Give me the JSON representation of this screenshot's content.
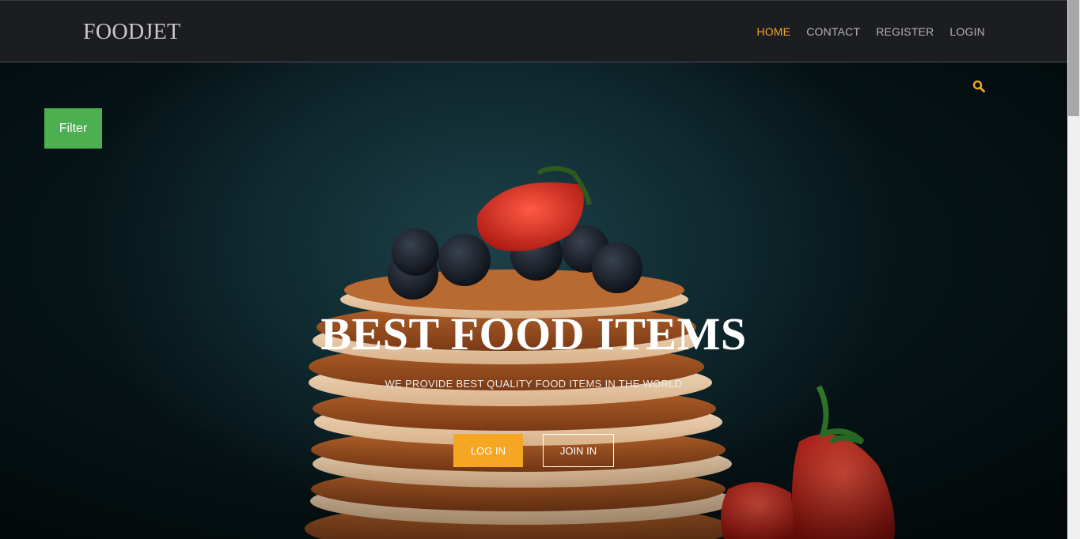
{
  "header": {
    "brand": "FOODJET",
    "nav": [
      {
        "label": "HOME",
        "active": true
      },
      {
        "label": "CONTACT",
        "active": false
      },
      {
        "label": "REGISTER",
        "active": false
      },
      {
        "label": "LOGIN",
        "active": false
      }
    ]
  },
  "hero": {
    "filter_label": "Filter",
    "title": "BEST FOOD ITEMS",
    "subtitle": "WE PROVIDE BEST QUALITY FOOD ITEMS IN THE WORLD",
    "login_label": "LOG IN",
    "join_label": "JOIN IN",
    "search_icon": "search-icon",
    "background_image": "pancake-stack-with-berries"
  },
  "colors": {
    "accent": "#f5a623",
    "filter_green": "#4caf50",
    "header_bg": "#1c1d21",
    "nav_text": "#b5b5b5"
  }
}
